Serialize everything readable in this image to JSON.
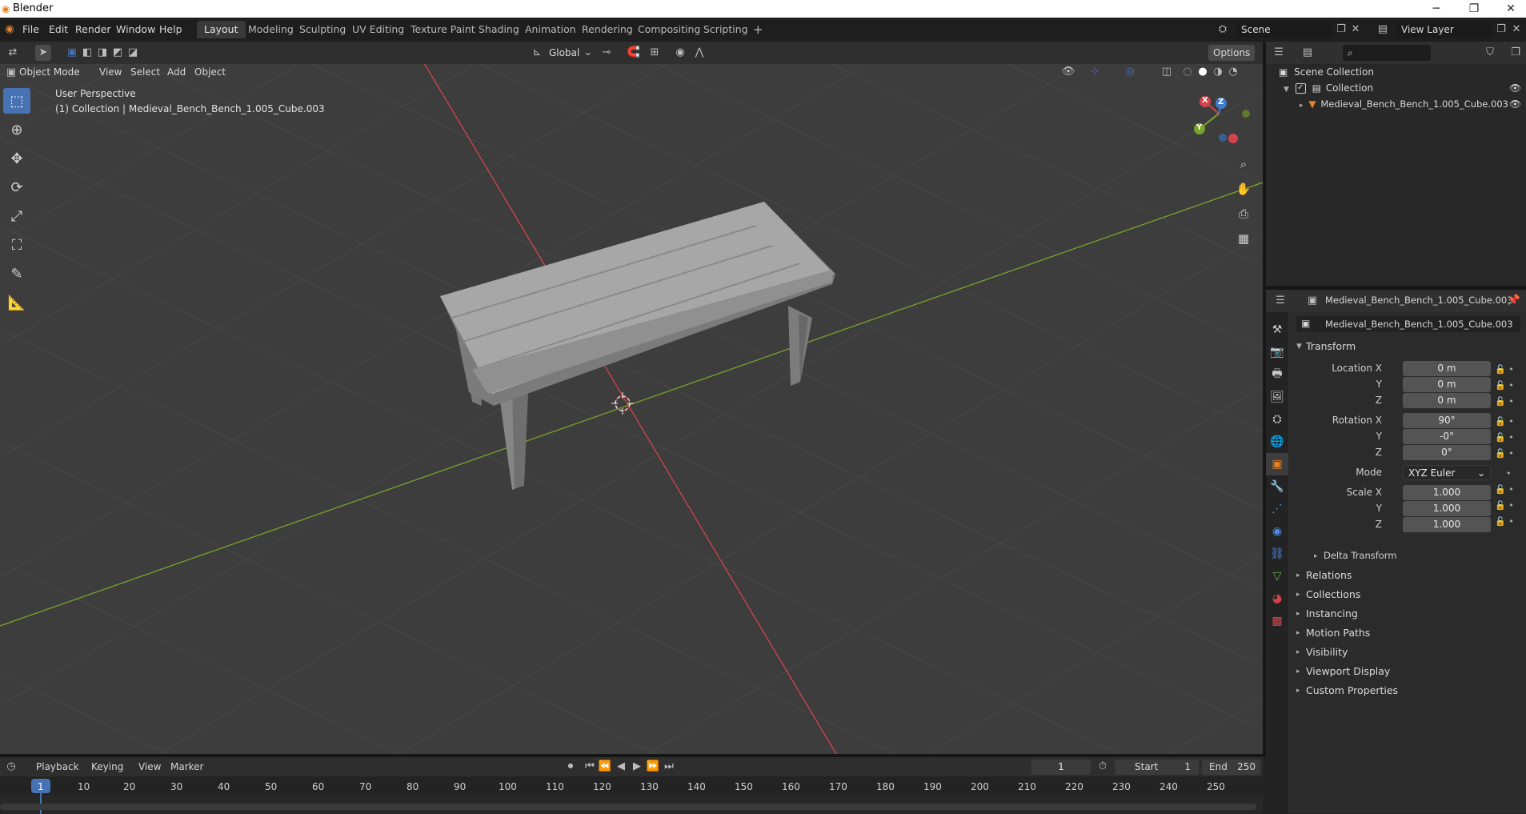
{
  "window": {
    "title": "Blender",
    "controls": [
      "─",
      "❐",
      "✕"
    ]
  },
  "menu": [
    "File",
    "Edit",
    "Render",
    "Window",
    "Help"
  ],
  "workspaces": [
    {
      "label": "Layout",
      "active": true
    },
    {
      "label": "Modeling"
    },
    {
      "label": "Sculpting"
    },
    {
      "label": "UV Editing"
    },
    {
      "label": "Texture Paint"
    },
    {
      "label": "Shading"
    },
    {
      "label": "Animation"
    },
    {
      "label": "Rendering"
    },
    {
      "label": "Compositing"
    },
    {
      "label": "Scripting"
    }
  ],
  "add_workspace": "+",
  "scene": {
    "value": "Scene"
  },
  "view_layer": {
    "value": "View Layer"
  },
  "viewport": {
    "mode": "Object Mode",
    "menus": [
      "View",
      "Select",
      "Add",
      "Object"
    ],
    "transform_orientation": "Global",
    "options": "Options",
    "overlay_line1": "User Perspective",
    "overlay_line2": "(1) Collection | Medieval_Bench_Bench_1.005_Cube.003",
    "gizmo": {
      "x": "X",
      "y": "Y",
      "z": "Z"
    }
  },
  "outliner": {
    "scene_collection": "Scene Collection",
    "collection": "Collection",
    "object": "Medieval_Bench_Bench_1.005_Cube.003"
  },
  "properties": {
    "header_object": "Medieval_Bench_Bench_1.005_Cube.003",
    "name_field": "Medieval_Bench_Bench_1.005_Cube.003",
    "transform_title": "Transform",
    "location_label": "Location X",
    "rotation_label": "Rotation X",
    "scale_label": "Scale X",
    "y_label": "Y",
    "z_label": "Z",
    "location": {
      "x": "0 m",
      "y": "0 m",
      "z": "0 m"
    },
    "rotation": {
      "x": "90°",
      "y": "-0°",
      "z": "0°"
    },
    "mode_label": "Mode",
    "mode_value": "XYZ Euler",
    "scale": {
      "x": "1.000",
      "y": "1.000",
      "z": "1.000"
    },
    "delta_transform": "Delta Transform",
    "panels": [
      "Relations",
      "Collections",
      "Instancing",
      "Motion Paths",
      "Visibility",
      "Viewport Display",
      "Custom Properties"
    ]
  },
  "timeline": {
    "menus": [
      "Playback",
      "Keying",
      "View",
      "Marker"
    ],
    "current_frame": "1",
    "start_label": "Start",
    "start_value": "1",
    "end_label": "End",
    "end_value": "250",
    "ruler": [
      "1",
      "10",
      "20",
      "30",
      "40",
      "50",
      "60",
      "70",
      "80",
      "90",
      "100",
      "110",
      "120",
      "130",
      "140",
      "150",
      "160",
      "170",
      "180",
      "190",
      "200",
      "210",
      "220",
      "230",
      "240",
      "250"
    ]
  },
  "colors": {
    "accent": "#4772b3",
    "x_axis": "#d4434c",
    "y_axis": "#7ba22b",
    "z_axis": "#3f7ccf"
  }
}
